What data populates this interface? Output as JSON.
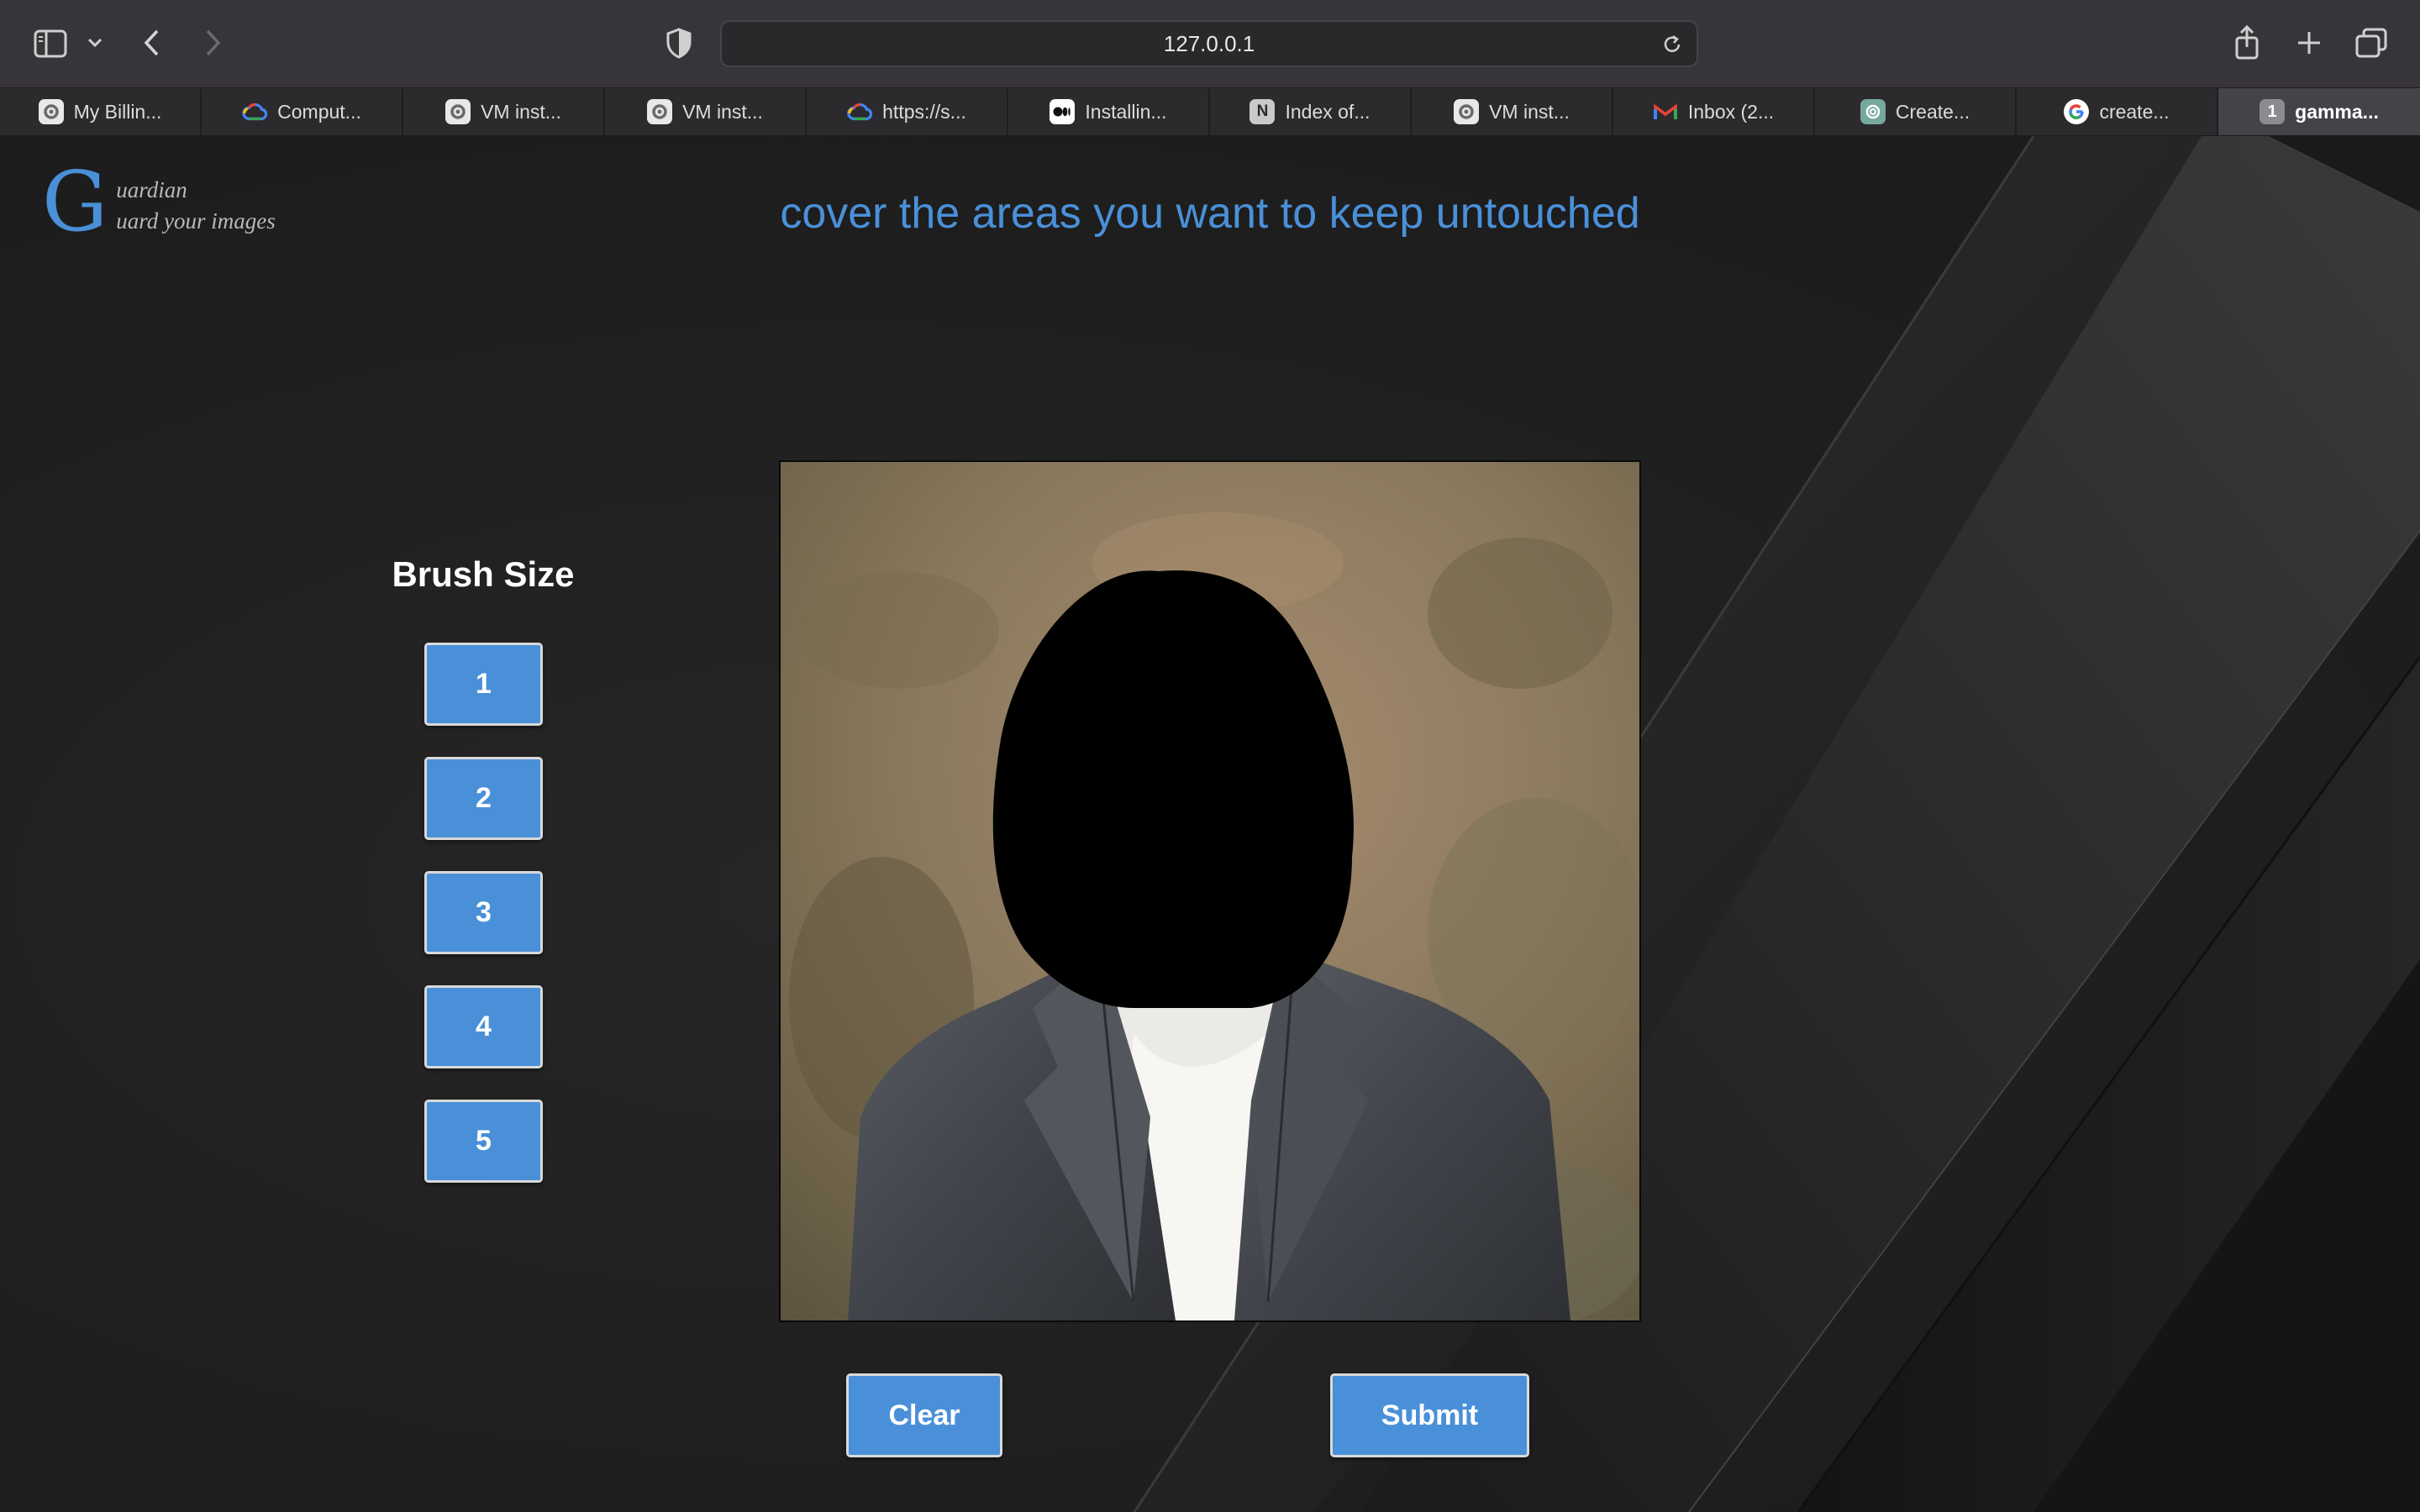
{
  "browser": {
    "url": "127.0.0.1",
    "tabs": [
      {
        "label": "My Billin...",
        "icon": "gear-badge-icon"
      },
      {
        "label": "Comput...",
        "icon": "google-cloud-icon"
      },
      {
        "label": "VM inst...",
        "icon": "gear-badge-icon"
      },
      {
        "label": "VM inst...",
        "icon": "gear-badge-icon"
      },
      {
        "label": "https://s...",
        "icon": "google-cloud-icon"
      },
      {
        "label": "Installin...",
        "icon": "medium-icon"
      },
      {
        "label": "Index of...",
        "icon": "notion-icon"
      },
      {
        "label": "VM inst...",
        "icon": "gear-badge-icon"
      },
      {
        "label": "Inbox (2...",
        "icon": "gmail-icon"
      },
      {
        "label": "Create...",
        "icon": "openai-icon"
      },
      {
        "label": "create...",
        "icon": "google-icon"
      },
      {
        "label": "gamma...",
        "icon": "tab-number-icon",
        "badge": "1",
        "active": true
      }
    ]
  },
  "app": {
    "logo_letter": "G",
    "logo_line1": "uardian",
    "logo_line2": "uard your images",
    "headline": "cover the areas you want to keep untouched",
    "brush_title": "Brush Size",
    "brush_sizes": [
      "1",
      "2",
      "3",
      "4",
      "5"
    ],
    "clear_label": "Clear",
    "submit_label": "Submit"
  },
  "colors": {
    "accent": "#4a90d9",
    "toolbar": "#38353a",
    "page_bg": "#1d1d1d"
  }
}
